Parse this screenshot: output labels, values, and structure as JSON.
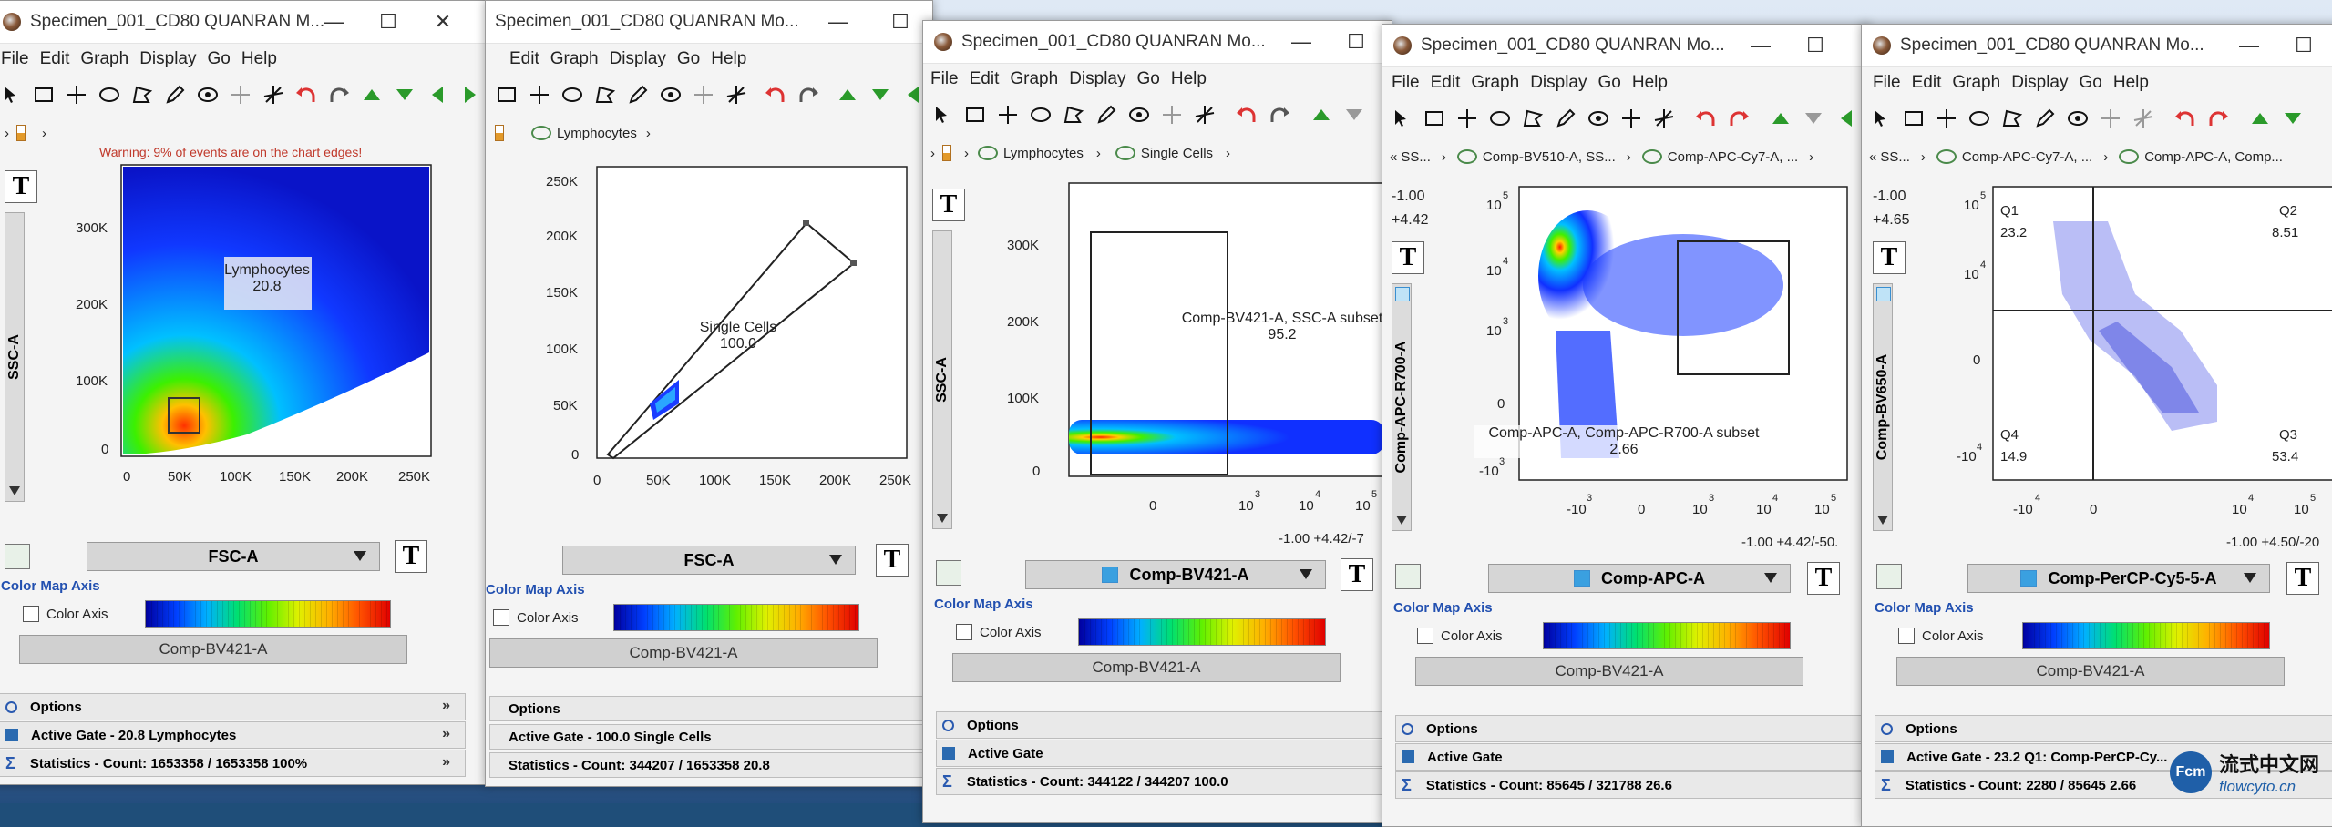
{
  "menu": [
    "File",
    "Edit",
    "Graph",
    "Display",
    "Go",
    "Help"
  ],
  "colors": {
    "accent": "#2250b0",
    "warning": "#c0392b",
    "desktop": "#1f4e79"
  },
  "icons": [
    "arrow-pointer-icon",
    "rectangle-icon",
    "crosshair-icon",
    "ellipse-icon",
    "polygon-icon",
    "pencil-icon",
    "spider-icon",
    "quad-icon",
    "quad-skew-icon",
    "undo-icon",
    "redo-icon",
    "up-icon",
    "down-icon",
    "prev-icon",
    "next-icon"
  ],
  "windows": [
    {
      "title": "Specimen_001_CD80 QUANRAN M...",
      "warning": "Warning: 9% of events are on the chart edges!",
      "y_label": "SSC-A",
      "x_param": "FSC-A",
      "y_ticks": [
        "300K",
        "200K",
        "100K",
        "0"
      ],
      "x_ticks": [
        "0",
        "50K",
        "100K",
        "150K",
        "200K",
        "250K"
      ],
      "gate": {
        "name": "Lymphocytes",
        "value": "20.8"
      },
      "color_axis": "Color Axis",
      "color_map_axis": "Color Map Axis",
      "color_param": "Comp-BV421-A",
      "options": "Options",
      "active_gate": "Active Gate - 20.8 Lymphocytes",
      "statistics": "Statistics  -  Count: 1653358 / 1653358      100%"
    },
    {
      "title": "Specimen_001_CD80 QUANRAN Mo...",
      "crumbs": [
        "Lymphocytes"
      ],
      "y_ticks": [
        "250K",
        "200K",
        "150K",
        "100K",
        "50K",
        "0"
      ],
      "x_ticks": [
        "0",
        "50K",
        "100K",
        "150K",
        "200K",
        "250K"
      ],
      "x_param": "FSC-A",
      "gate": {
        "name": "Single Cells",
        "value": "100.0"
      },
      "color_axis": "Color Axis",
      "color_map_axis": "Color Map Axis",
      "color_param": "Comp-BV421-A",
      "options": "Options",
      "active_gate": "Active Gate  -  100.0 Single Cells",
      "statistics": "Statistics  -  Count: 344207 / 1653358      20.8"
    },
    {
      "title": "Specimen_001_CD80 QUANRAN Mo...",
      "crumbs": [
        "Lymphocytes",
        "Single Cells"
      ],
      "y_label": "SSC-A",
      "y_ticks": [
        "300K",
        "200K",
        "100K",
        "0"
      ],
      "x_ticks": [
        "0",
        "10",
        "10",
        "10"
      ],
      "x_exps": [
        "3",
        "4",
        "5"
      ],
      "x_param": "Comp-BV421-A",
      "range_text": "-1.00 +4.42/-7",
      "gate": {
        "name": "Comp-BV421-A, SSC-A subset",
        "value": "95.2"
      },
      "color_axis": "Color Axis",
      "color_map_axis": "Color Map Axis",
      "color_param": "Comp-BV421-A",
      "options": "Options",
      "active_gate": "Active Gate",
      "statistics": "Statistics  -  Count: 344122 / 344207      100.0"
    },
    {
      "title": "Specimen_001_CD80 QUANRAN Mo...",
      "crumbs": [
        "SS...",
        "Comp-BV510-A, SS...",
        "Comp-APC-Cy7-A, ..."
      ],
      "y_label": "Comp-APC-R700-A",
      "y_top": "-1.00",
      "y_top2": "+4.42",
      "y_ticks": [
        "10",
        "10",
        "10",
        "0",
        "-10"
      ],
      "y_exps": [
        "5",
        "4",
        "3",
        "3"
      ],
      "x_ticks": [
        "-10",
        "0",
        "10",
        "10",
        "10"
      ],
      "x_exps": [
        "3",
        "3",
        "4",
        "5"
      ],
      "x_param": "Comp-APC-A",
      "range_text": "-1.00 +4.42/-50.",
      "gate": {
        "name": "Comp-APC-A, Comp-APC-R700-A subset",
        "value": "2.66"
      },
      "color_axis": "Color Axis",
      "color_map_axis": "Color Map Axis",
      "color_param": "Comp-BV421-A",
      "options": "Options",
      "active_gate": "Active Gate",
      "statistics": "Statistics  -  Count: 85645 / 321788      26.6"
    },
    {
      "title": "Specimen_001_CD80 QUANRAN Mo...",
      "crumbs": [
        "SS...",
        "Comp-APC-Cy7-A, ...",
        "Comp-APC-A, Comp..."
      ],
      "y_label": "Comp-BV650-A",
      "y_top": "-1.00",
      "y_top2": "+4.65",
      "y_ticks": [
        "10",
        "10",
        "0",
        "-10"
      ],
      "y_exps": [
        "5",
        "4",
        "4"
      ],
      "x_ticks": [
        "-10",
        "0",
        "10",
        "10"
      ],
      "x_exps": [
        "4",
        "4",
        "5"
      ],
      "x_param": "Comp-PerCP-Cy5-5-A",
      "range_text": "-1.00 +4.50/-20",
      "quads": [
        {
          "name": "Q1",
          "value": "23.2"
        },
        {
          "name": "Q2",
          "value": "8.51"
        },
        {
          "name": "Q4",
          "value": "14.9"
        },
        {
          "name": "Q3",
          "value": "53.4"
        }
      ],
      "color_axis": "Color Axis",
      "color_map_axis": "Color Map Axis",
      "color_param": "Comp-BV421-A",
      "options": "Options",
      "active_gate": "Active Gate  -  23.2 Q1: Comp-PerCP-Cy...",
      "statistics": "Statistics  -  Count: 2280 / 85645      2.66"
    }
  ],
  "watermark": {
    "cn": "流式中文网",
    "en": "flowcyto.cn"
  }
}
